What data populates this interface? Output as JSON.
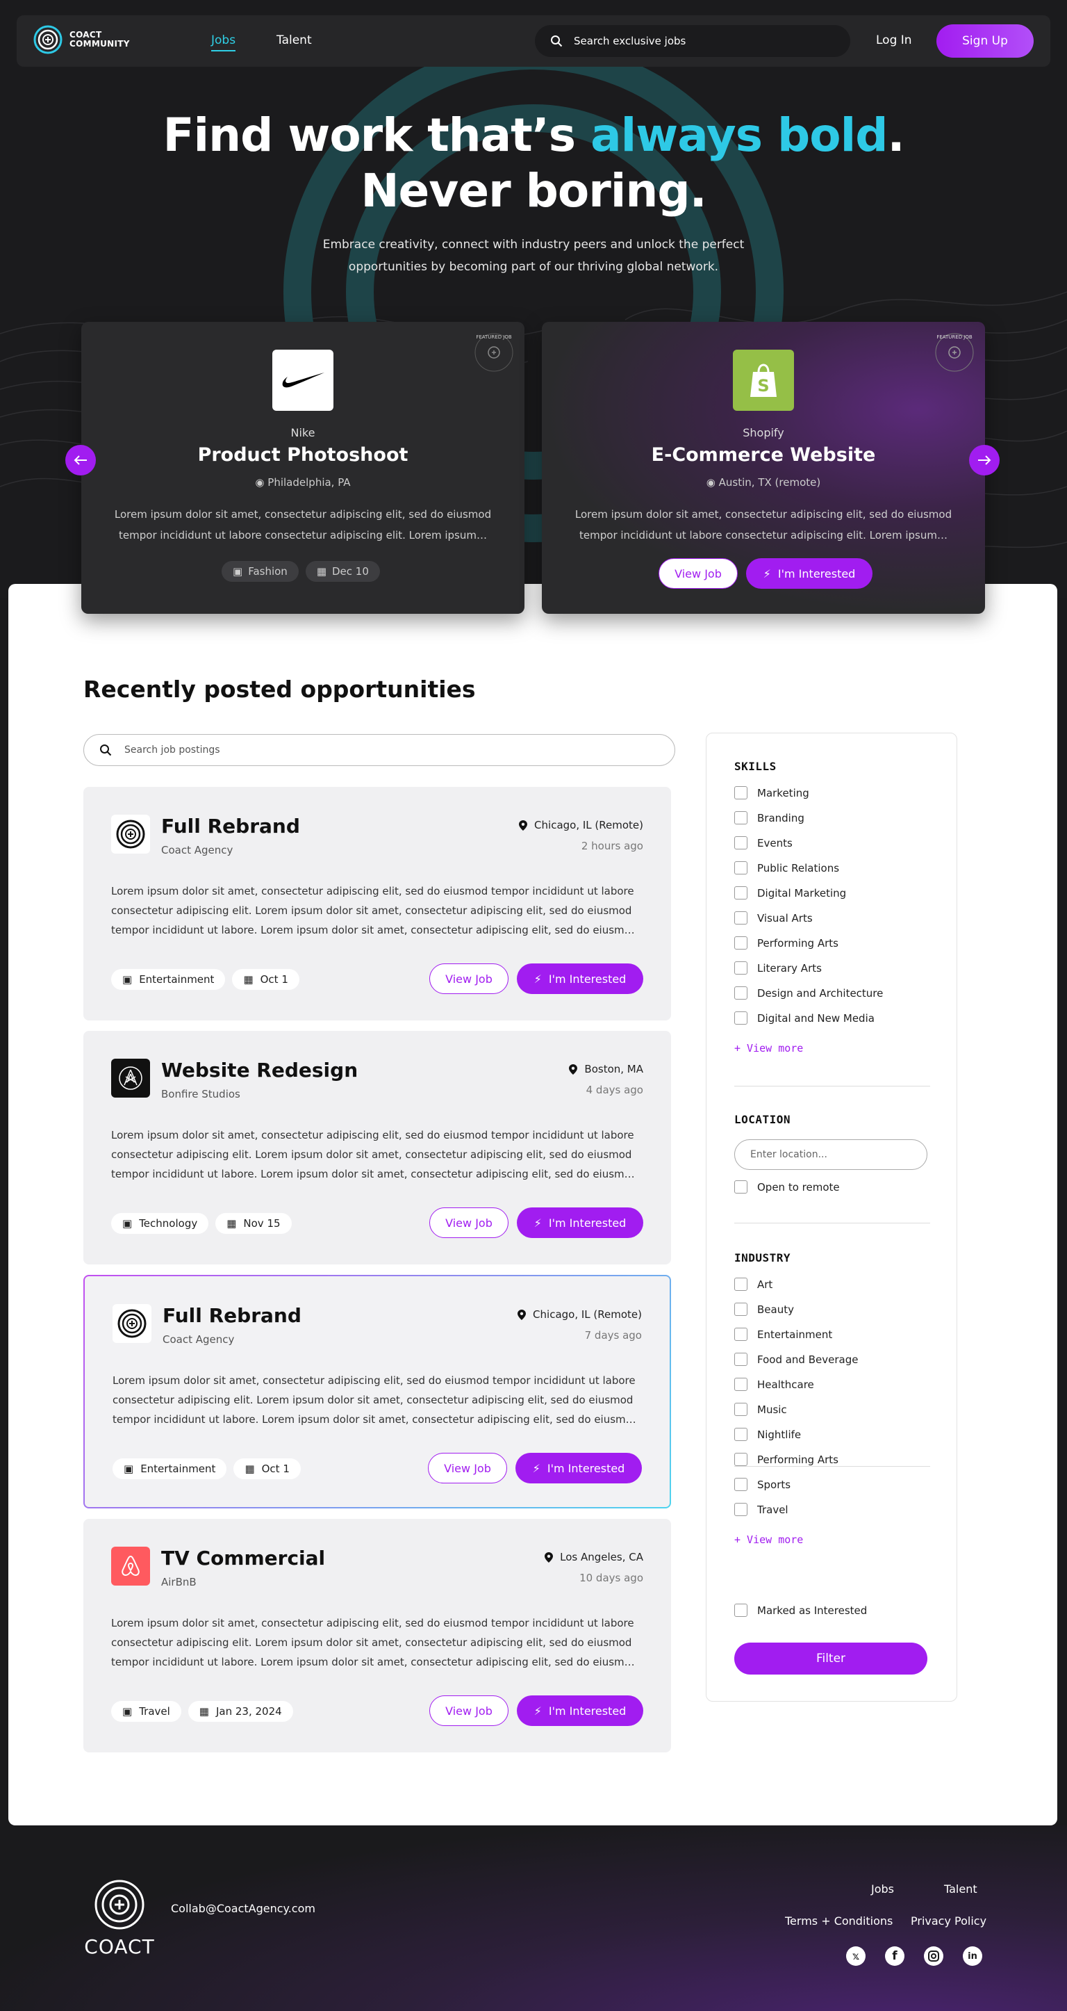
{
  "nav": {
    "logo_line1": "COACT",
    "logo_line2": "COMMUNITY",
    "links": [
      "Jobs",
      "Talent"
    ],
    "search_placeholder": "Search exclusive jobs",
    "login": "Log In",
    "signup": "Sign Up"
  },
  "hero": {
    "title_part1": "Find work that’s ",
    "title_accent": "always bold",
    "title_period": ".",
    "title_line2": "Never boring.",
    "subtitle": "Embrace creativity, connect with industry peers and unlock the perfect opportunities by becoming part of our thriving global network."
  },
  "featured": [
    {
      "company": "Nike",
      "title": "Product Photoshoot",
      "location": "Philadelphia, PA",
      "description": "Lorem ipsum dolor sit amet, consectetur adipiscing elit, sed do eiusmod tempor incididunt ut labore consectetur adipiscing elit. Lorem ipsum…",
      "tags": [
        "Fashion",
        "Dec 10"
      ],
      "stamp": "FEATURED JOB"
    },
    {
      "company": "Shopify",
      "title": "E-Commerce Website",
      "location": "Austin, TX (remote)",
      "description": "Lorem ipsum dolor sit amet, consectetur adipiscing elit, sed do eiusmod tempor incididunt ut labore consectetur adipiscing elit. Lorem ipsum…",
      "view": "View Job",
      "interested": "I'm Interested",
      "stamp": "FEATURED JOB"
    }
  ],
  "listings": {
    "heading": "Recently posted opportunities",
    "search_placeholder": "Search job postings",
    "jobs": [
      {
        "title": "Full Rebrand",
        "company": "Coact Agency",
        "location": "Chicago, IL (Remote)",
        "posted": "2 hours ago",
        "description": "Lorem ipsum dolor sit amet, consectetur adipiscing elit, sed do eiusmod tempor incididunt ut labore consectetur adipiscing elit. Lorem ipsum dolor sit amet, consectetur adipiscing elit, sed do eiusmod tempor incididunt ut labore. Lorem ipsum dolor sit amet, consectetur adipiscing elit, sed do eiusm…",
        "category": "Entertainment",
        "date": "Oct 1",
        "view": "View Job",
        "interested": "I'm Interested"
      },
      {
        "title": "Website Redesign",
        "company": "Bonfire Studios",
        "location": "Boston, MA",
        "posted": "4 days ago",
        "description": "Lorem ipsum dolor sit amet, consectetur adipiscing elit, sed do eiusmod tempor incididunt ut labore consectetur adipiscing elit. Lorem ipsum dolor sit amet, consectetur adipiscing elit, sed do eiusmod tempor incididunt ut labore. Lorem ipsum dolor sit amet, consectetur adipiscing elit, sed do eiusm…",
        "category": "Technology",
        "date": "Nov 15",
        "view": "View Job",
        "interested": "I'm Interested"
      },
      {
        "title": "Full Rebrand",
        "company": "Coact Agency",
        "location": "Chicago, IL (Remote)",
        "posted": "7 days ago",
        "description": "Lorem ipsum dolor sit amet, consectetur adipiscing elit, sed do eiusmod tempor incididunt ut labore consectetur adipiscing elit. Lorem ipsum dolor sit amet, consectetur adipiscing elit, sed do eiusmod tempor incididunt ut labore. Lorem ipsum dolor sit amet, consectetur adipiscing elit, sed do eiusm…",
        "category": "Entertainment",
        "date": "Oct 1",
        "view": "View Job",
        "interested": "I'm Interested"
      },
      {
        "title": "TV Commercial",
        "company": "AirBnB",
        "location": "Los Angeles, CA",
        "posted": "10 days ago",
        "description": "Lorem ipsum dolor sit amet, consectetur adipiscing elit, sed do eiusmod tempor incididunt ut labore consectetur adipiscing elit. Lorem ipsum dolor sit amet, consectetur adipiscing elit, sed do eiusmod tempor incididunt ut labore. Lorem ipsum dolor sit amet, consectetur adipiscing elit, sed do eiusm…",
        "category": "Travel",
        "date": "Jan 23, 2024",
        "view": "View Job",
        "interested": "I'm Interested"
      }
    ]
  },
  "filters": {
    "skills_heading": "SKILLS",
    "skills": [
      "Marketing",
      "Branding",
      "Events",
      "Public Relations",
      "Digital Marketing",
      "Visual Arts",
      "Performing Arts",
      "Literary Arts",
      "Design and Architecture",
      "Digital and New Media"
    ],
    "view_more": "+ View more",
    "location_heading": "LOCATION",
    "location_placeholder": "Enter location...",
    "remote": "Open to remote",
    "industry_heading": "INDUSTRY",
    "industries": [
      "Art",
      "Beauty",
      "Entertainment",
      "Food and Beverage",
      "Healthcare",
      "Music",
      "Nightlife",
      "Performing Arts",
      "Sports",
      "Travel"
    ],
    "marked": "Marked as Interested",
    "filter_button": "Filter"
  },
  "footer": {
    "logo": "COACT",
    "email": "Collab@CoactAgency.com",
    "links": [
      "Jobs",
      "Talent"
    ],
    "legal": [
      "Terms + Conditions",
      "Privacy Policy"
    ],
    "socials": [
      "x-icon",
      "facebook-icon",
      "instagram-icon",
      "linkedin-icon"
    ]
  },
  "colors": {
    "accent": "#a11df0",
    "cyan": "#2ec9e6",
    "dark": "#1b1b1d"
  }
}
